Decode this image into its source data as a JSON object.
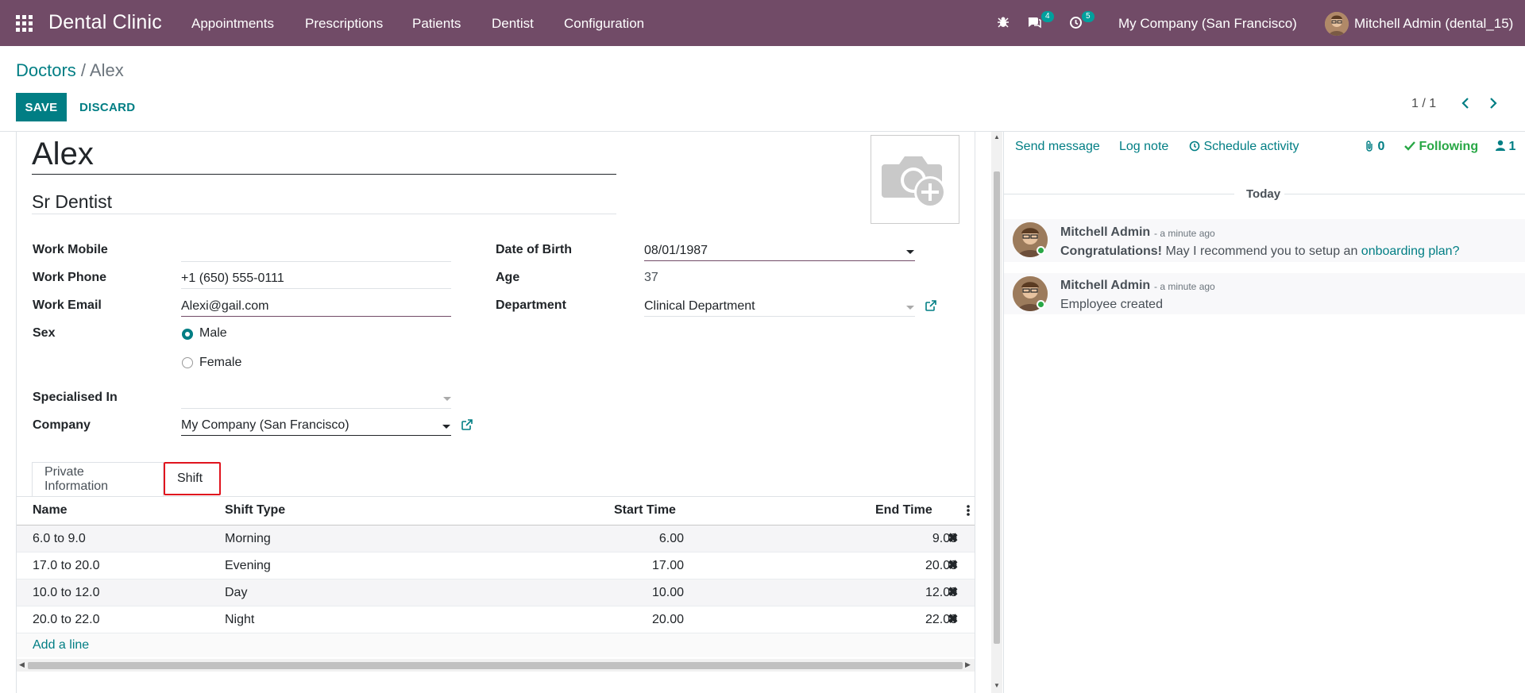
{
  "navbar": {
    "brand": "Dental Clinic",
    "menu": [
      "Appointments",
      "Prescriptions",
      "Patients",
      "Dentist",
      "Configuration"
    ],
    "messages_count": "4",
    "activities_count": "5",
    "company": "My Company (San Francisco)",
    "user": "Mitchell Admin (dental_15)"
  },
  "breadcrumb": {
    "parent": "Doctors",
    "separator": " / ",
    "current": "Alex"
  },
  "control": {
    "save_label": "SAVE",
    "discard_label": "DISCARD",
    "pager": "1 / 1"
  },
  "form": {
    "name": "Alex",
    "job_title": "Sr Dentist",
    "work_mobile_label": "Work Mobile",
    "work_mobile": "",
    "work_phone_label": "Work Phone",
    "work_phone": "+1 (650) 555-0111",
    "work_email_label": "Work Email",
    "work_email": "Alexi@gail.com",
    "sex_label": "Sex",
    "sex_options": [
      "Male",
      "Female"
    ],
    "sex_selected": "Male",
    "specialised_label": "Specialised In",
    "specialised": "",
    "company_label": "Company",
    "company": "My Company (San Francisco)",
    "dob_label": "Date of Birth",
    "dob": "08/01/1987",
    "age_label": "Age",
    "age": "37",
    "department_label": "Department",
    "department": "Clinical Department"
  },
  "tabs": [
    "Private Information",
    "Shift"
  ],
  "active_tab": "Shift",
  "shift_table": {
    "columns": [
      "Name",
      "Shift Type",
      "Start Time",
      "End Time"
    ],
    "rows": [
      {
        "name": "6.0 to 9.0",
        "type": "Morning",
        "start": "6.00",
        "end": "9.00"
      },
      {
        "name": "17.0 to 20.0",
        "type": "Evening",
        "start": "17.00",
        "end": "20.00"
      },
      {
        "name": "10.0 to 12.0",
        "type": "Day",
        "start": "10.00",
        "end": "12.00"
      },
      {
        "name": "20.0 to 22.0",
        "type": "Night",
        "start": "20.00",
        "end": "22.00"
      }
    ],
    "add_line": "Add a line"
  },
  "chatter": {
    "send_message": "Send message",
    "log_note": "Log note",
    "schedule_activity": "Schedule activity",
    "attachments": "0",
    "following": "Following",
    "followers": "1",
    "today": "Today",
    "messages": [
      {
        "author": "Mitchell Admin",
        "time": "- a minute ago",
        "bold": "Congratulations!",
        "body": " May I recommend you to setup an ",
        "link": "onboarding plan?"
      },
      {
        "author": "Mitchell Admin",
        "time": "- a minute ago",
        "body": "Employee created"
      }
    ]
  },
  "colors": {
    "brand": "#714B67",
    "accent": "#017E84",
    "highlight": "#e0141e"
  }
}
